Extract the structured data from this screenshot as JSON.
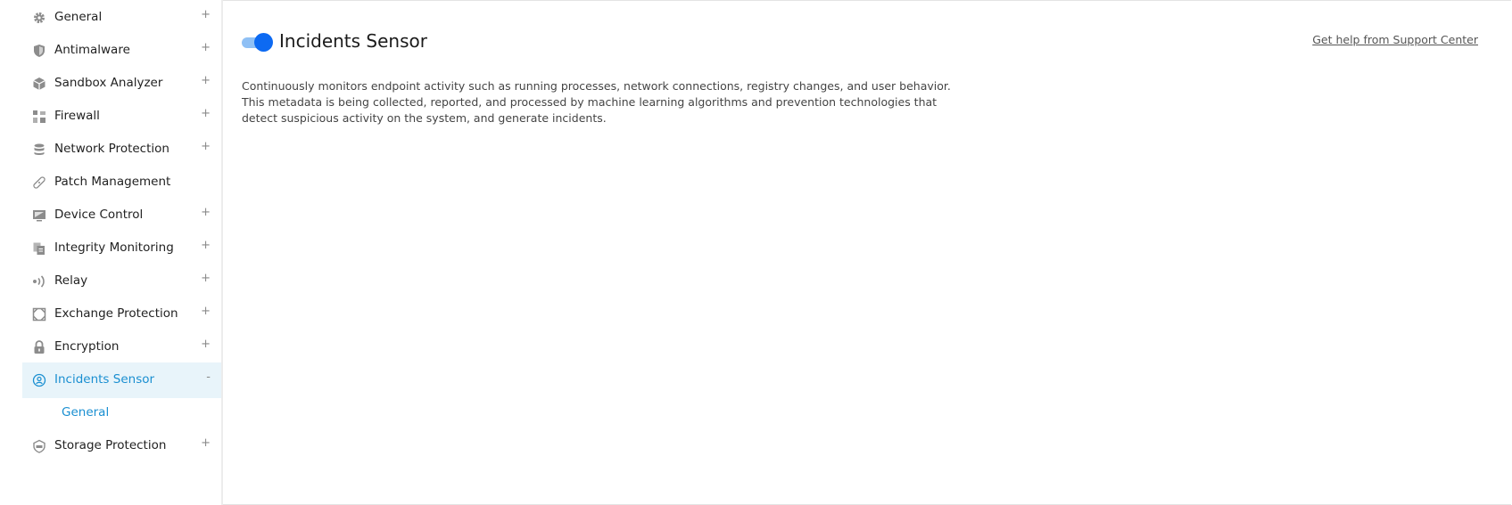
{
  "sidebar": {
    "items": [
      {
        "label": "General",
        "icon": "gear-icon",
        "expand": "+"
      },
      {
        "label": "Antimalware",
        "icon": "shield-icon",
        "expand": "+"
      },
      {
        "label": "Sandbox Analyzer",
        "icon": "cube-icon",
        "expand": "+"
      },
      {
        "label": "Firewall",
        "icon": "firewall-icon",
        "expand": "+"
      },
      {
        "label": "Network Protection",
        "icon": "database-icon",
        "expand": "+"
      },
      {
        "label": "Patch Management",
        "icon": "bandage-icon",
        "expand": ""
      },
      {
        "label": "Device Control",
        "icon": "monitor-icon",
        "expand": "+"
      },
      {
        "label": "Integrity Monitoring",
        "icon": "documents-icon",
        "expand": "+"
      },
      {
        "label": "Relay",
        "icon": "broadcast-icon",
        "expand": "+"
      },
      {
        "label": "Exchange Protection",
        "icon": "exchange-icon",
        "expand": "+"
      },
      {
        "label": "Encryption",
        "icon": "lock-icon",
        "expand": "+"
      },
      {
        "label": "Incidents Sensor",
        "icon": "sensor-icon",
        "expand": "-"
      },
      {
        "label": "General",
        "icon": "",
        "expand": ""
      },
      {
        "label": "Storage Protection",
        "icon": "storage-icon",
        "expand": "+"
      }
    ]
  },
  "main": {
    "title": "Incidents Sensor",
    "toggle_state": "on",
    "help_link": "Get help from Support Center",
    "description": "Continuously monitors endpoint activity such as running processes, network connections, registry changes, and user behavior. This metadata is being collected, reported, and processed by machine learning algorithms and prevention technologies that detect suspicious activity on the system, and generate incidents."
  },
  "colors": {
    "accent": "#1a8fd1",
    "toggle_on": "#0d6af2",
    "active_bg": "#e8f4fa"
  }
}
